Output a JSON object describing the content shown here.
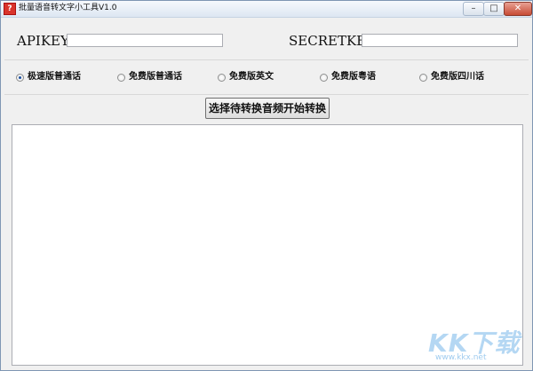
{
  "window": {
    "title": "批量语音转文字小工具V1.0",
    "icon_glyph": "?",
    "controls": {
      "minimize": "–",
      "maximize": "□",
      "close": "✕"
    }
  },
  "credentials": {
    "apikey_label": "APIKEY",
    "apikey_value": "",
    "secretkey_label": "SECRETKEY",
    "secretkey_value": ""
  },
  "modes": [
    {
      "label": "极速版普通话",
      "selected": true
    },
    {
      "label": "免费版普通话",
      "selected": false
    },
    {
      "label": "免费版英文",
      "selected": false
    },
    {
      "label": "免费版粤语",
      "selected": false
    },
    {
      "label": "免费版四川话",
      "selected": false
    }
  ],
  "action": {
    "start_label": "选择待转换音频开始转换"
  },
  "log": {
    "text": ""
  },
  "watermark": {
    "main": "KK下载",
    "sub": "www.kkx.net"
  },
  "colors": {
    "accent": "#1a4fa0",
    "close_button": "#c74b34"
  }
}
